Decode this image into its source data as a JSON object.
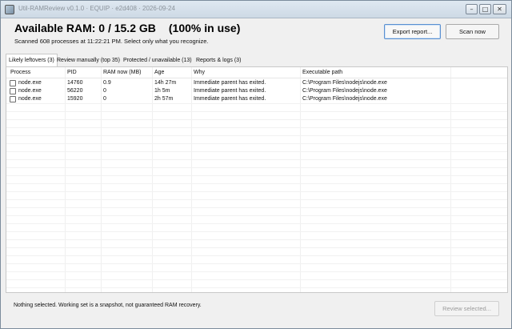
{
  "window": {
    "title": "Util-RAMReview v0.1.0 · EQUIP · e2d408 · 2026-09-24",
    "minimize_glyph": "–",
    "maximize_glyph": "□",
    "close_glyph": "✕"
  },
  "header": {
    "available": "Available RAM: 0 / 15.2 GB",
    "usage": "(100% in use)",
    "subtitle": "Scanned 608 processes at 11:22:21 PM. Select only what you recognize."
  },
  "toolbar": {
    "export_label": "Export report...",
    "scan_label": "Scan now"
  },
  "tabs": [
    {
      "label": "Likely leftovers (3)",
      "active": true
    },
    {
      "label": "Review manually (top 35)",
      "active": false
    },
    {
      "label": "Protected / unavailable (13)",
      "active": false
    },
    {
      "label": "Reports & logs (3)",
      "active": false
    }
  ],
  "table": {
    "columns": [
      "Process",
      "PID",
      "RAM now (MB)",
      "Age",
      "Why",
      "Executable path"
    ],
    "rows": [
      {
        "process": "node.exe",
        "pid": "14760",
        "ram": "0.9",
        "age": "14h 27m",
        "why": "Immediate parent has exited.",
        "path": "C:\\Program Files\\nodejs\\node.exe",
        "checked": false
      },
      {
        "process": "node.exe",
        "pid": "56220",
        "ram": "0",
        "age": "1h 5m",
        "why": "Immediate parent has exited.",
        "path": "C:\\Program Files\\nodejs\\node.exe",
        "checked": false
      },
      {
        "process": "node.exe",
        "pid": "15920",
        "ram": "0",
        "age": "2h 57m",
        "why": "Immediate parent has exited.",
        "path": "C:\\Program Files\\nodejs\\node.exe",
        "checked": false
      }
    ]
  },
  "footer": {
    "note": "Nothing selected. Working set is a snapshot, not guaranteed RAM recovery.",
    "review_label": "Review selected..."
  }
}
